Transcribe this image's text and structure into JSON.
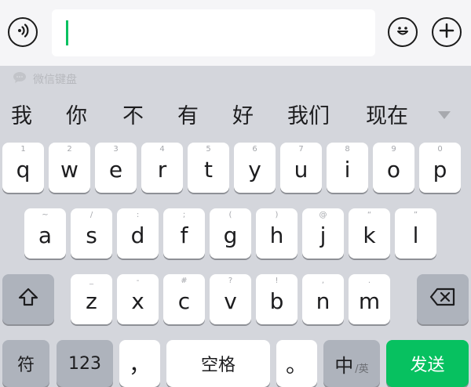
{
  "input_bar": {
    "value": "",
    "voice_icon": "voice-icon",
    "emoji_icon": "emoji-icon",
    "plus_icon": "plus-icon"
  },
  "keyboard": {
    "brand_label": "微信键盘",
    "candidates": [
      "我",
      "你",
      "不",
      "有",
      "好",
      "我们",
      "现在"
    ],
    "rows": [
      {
        "keys": [
          {
            "label": "q",
            "hint": "1"
          },
          {
            "label": "w",
            "hint": "2"
          },
          {
            "label": "e",
            "hint": "3"
          },
          {
            "label": "r",
            "hint": "4"
          },
          {
            "label": "t",
            "hint": "5"
          },
          {
            "label": "y",
            "hint": "6"
          },
          {
            "label": "u",
            "hint": "7"
          },
          {
            "label": "i",
            "hint": "8"
          },
          {
            "label": "o",
            "hint": "9"
          },
          {
            "label": "p",
            "hint": "0"
          }
        ]
      },
      {
        "keys": [
          {
            "label": "a",
            "hint": "~"
          },
          {
            "label": "s",
            "hint": "/"
          },
          {
            "label": "d",
            "hint": ":"
          },
          {
            "label": "f",
            "hint": ";"
          },
          {
            "label": "g",
            "hint": "("
          },
          {
            "label": "h",
            "hint": ")"
          },
          {
            "label": "j",
            "hint": "@"
          },
          {
            "label": "k",
            "hint": "“"
          },
          {
            "label": "l",
            "hint": "”"
          }
        ]
      },
      {
        "keys": [
          {
            "label": "z",
            "hint": "_"
          },
          {
            "label": "x",
            "hint": "-"
          },
          {
            "label": "c",
            "hint": "#"
          },
          {
            "label": "v",
            "hint": "?"
          },
          {
            "label": "b",
            "hint": "!"
          },
          {
            "label": "n",
            "hint": ","
          },
          {
            "label": "m",
            "hint": "."
          }
        ]
      }
    ],
    "bottom": {
      "symbols": "符",
      "numbers": "123",
      "comma": "，",
      "space": "空格",
      "period": "。",
      "lang_main": "中",
      "lang_sub": "/英",
      "send": "发送"
    },
    "colors": {
      "accent": "#07c160",
      "key_bg": "#ffffff",
      "fn_key_bg": "#aeb3bc",
      "keyboard_bg": "#d4d6dc"
    }
  }
}
